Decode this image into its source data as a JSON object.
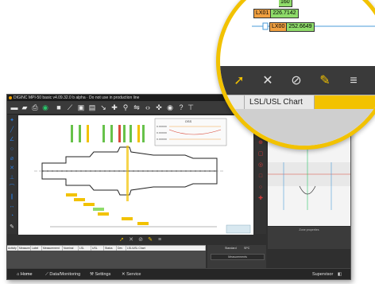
{
  "window": {
    "title": "DIGINC MPI-50 basic v4.09.32.0 b alpha · Do not use in production line"
  },
  "canvas": {
    "inset_chart_title": "OSS",
    "inset_labels": [
      "X.XXXXX",
      "X.XXXXX",
      "X.XXXXX"
    ]
  },
  "measurements_grid": {
    "columns": [
      "Activity",
      "Measured",
      "Label",
      "Measurement",
      "Nominal",
      "LSL",
      "USL",
      "Status",
      "Dev",
      "LSL/USL Chart"
    ]
  },
  "side_panel": {
    "tabs": [
      "Standard",
      "SPC"
    ],
    "button_label": "Measurements",
    "properties_label": "Zone properties"
  },
  "statusbar": {
    "items": [
      "Home",
      "Data/Monitoring",
      "Settings",
      "Service"
    ],
    "active": "Home",
    "user": "Supervisor"
  },
  "magnifier": {
    "readouts": [
      {
        "name": "",
        "value": "160"
      },
      {
        "name": "LX01",
        "value": "226.7142"
      },
      {
        "name": "LX00",
        "value": "252.6649"
      }
    ],
    "toolbar_icons": [
      "arrow-icon",
      "point-cross-icon",
      "cylinder-icon",
      "pencil-icon",
      "lines-icon"
    ],
    "tabs": [
      "s",
      "LSL/USL Chart",
      ""
    ]
  },
  "colors": {
    "accent": "#f2c200",
    "green_readout": "#8fdc6a",
    "orange_readout": "#f0a040",
    "dark_bg": "#2f2f2f"
  }
}
